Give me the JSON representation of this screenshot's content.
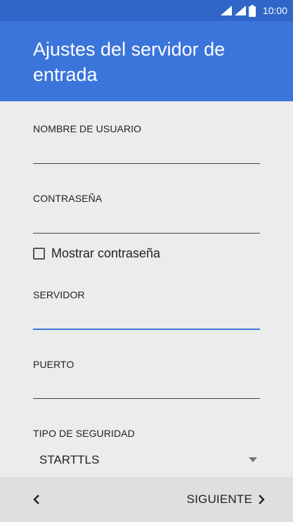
{
  "status_bar": {
    "time": "10:00",
    "icons": [
      "signal-icon",
      "signal-icon",
      "battery-icon"
    ]
  },
  "header": {
    "title": "Ajustes del servidor de entrada"
  },
  "form": {
    "username": {
      "label": "NOMBRE DE USUARIO",
      "value": ""
    },
    "password": {
      "label": "CONTRASEÑA",
      "value": ""
    },
    "show_password": {
      "label": "Mostrar contraseña",
      "checked": false
    },
    "server": {
      "label": "SERVIDOR",
      "value": ""
    },
    "port": {
      "label": "PUERTO",
      "value": ""
    },
    "security_type": {
      "label": "TIPO DE SEGURIDAD",
      "selected": "STARTTLS"
    }
  },
  "bottom_bar": {
    "back_icon": "chevron-left-icon",
    "next_label": "SIGUIENTE",
    "next_icon": "chevron-right-icon"
  },
  "colors": {
    "status_bar": "#2f66c8",
    "header": "#3b74db",
    "accent": "#3b74db",
    "background": "#ececec",
    "bottom_bar": "#dfdfdf"
  }
}
